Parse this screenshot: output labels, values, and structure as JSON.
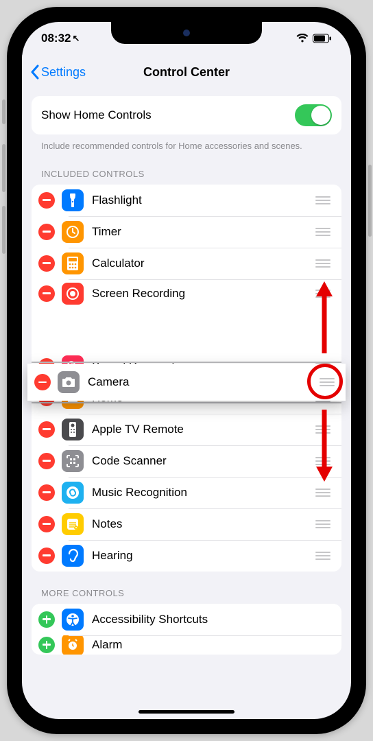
{
  "status": {
    "time": "08:32",
    "near_glyph": "↖"
  },
  "nav": {
    "back_label": "Settings",
    "title": "Control Center"
  },
  "toggle": {
    "label": "Show Home Controls"
  },
  "toggle_helper": "Include recommended controls for Home accessories and scenes.",
  "sections": {
    "included_header": "INCLUDED CONTROLS",
    "more_header": "MORE CONTROLS"
  },
  "included": [
    {
      "label": "Flashlight",
      "icon_name": "flashlight-icon",
      "icon_color": "ic-blue"
    },
    {
      "label": "Timer",
      "icon_name": "timer-icon",
      "icon_color": "ic-orange"
    },
    {
      "label": "Calculator",
      "icon_name": "calculator-icon",
      "icon_color": "ic-orange"
    },
    {
      "label": "Screen Recording",
      "icon_name": "screen-record-icon",
      "icon_color": "ic-red"
    },
    {
      "label": "Sound Recognition",
      "icon_name": "sound-recog-icon",
      "icon_color": "ic-pink"
    },
    {
      "label": "Home",
      "icon_name": "home-icon",
      "icon_color": "ic-orange"
    },
    {
      "label": "Apple TV Remote",
      "icon_name": "tv-remote-icon",
      "icon_color": "ic-graydark"
    },
    {
      "label": "Code Scanner",
      "icon_name": "qr-icon",
      "icon_color": "ic-grey"
    },
    {
      "label": "Music Recognition",
      "icon_name": "shazam-icon",
      "icon_color": "ic-cyan"
    },
    {
      "label": "Notes",
      "icon_name": "notes-icon",
      "icon_color": "ic-yellow"
    },
    {
      "label": "Hearing",
      "icon_name": "hearing-icon",
      "icon_color": "ic-blue"
    }
  ],
  "dragged": {
    "label": "Camera",
    "icon_name": "camera-icon",
    "icon_color": "ic-grey"
  },
  "more": [
    {
      "label": "Accessibility Shortcuts",
      "icon_name": "accessibility-icon",
      "icon_color": "ic-blue"
    },
    {
      "label": "Alarm",
      "icon_name": "alarm-icon",
      "icon_color": "ic-orange"
    }
  ],
  "annotation_color": "#e40000"
}
